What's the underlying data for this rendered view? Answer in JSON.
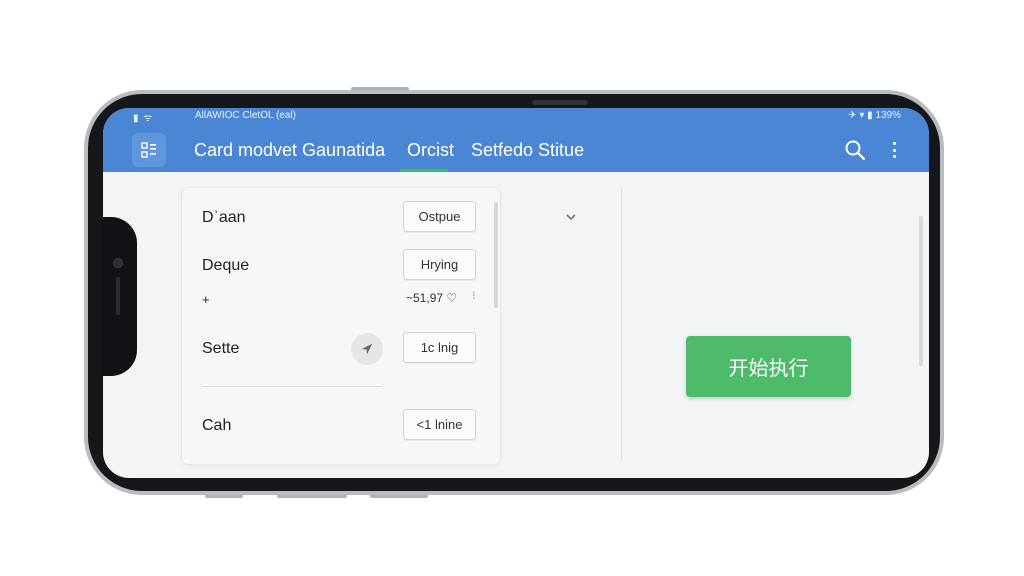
{
  "status_bar": {
    "signal": "▮ ᯤ",
    "app_name": "AllAWIOC CletOL (eal)",
    "indicators": "✈ ▾ ▮ 139%"
  },
  "app_bar": {
    "menu_icon": "grid-menu-icon",
    "tabs": [
      {
        "label": "Card modvet Gaunatida",
        "active": false
      },
      {
        "label": "Orcist",
        "active": true
      },
      {
        "label": "Setfedo Stitue",
        "active": false
      }
    ],
    "search_icon": "search-icon",
    "more_icon": "more-vertical-icon",
    "color": "#4a86d4",
    "active_tab_underline_color": "#3bbf5e"
  },
  "card": {
    "rows": [
      {
        "label": "Dˈaan",
        "chip": "Ostpue"
      },
      {
        "label": "Deque",
        "chip": "Hrying"
      },
      {
        "label": "Sette",
        "chip": "1c lnig"
      },
      {
        "label": "Cah",
        "chip": "<1 lnine"
      }
    ],
    "extra_row": {
      "plus": "+",
      "value": "~51,97 ♡",
      "mark": "⁝"
    }
  },
  "action_button": {
    "label": "开始执行",
    "color": "#4dbb6a"
  }
}
